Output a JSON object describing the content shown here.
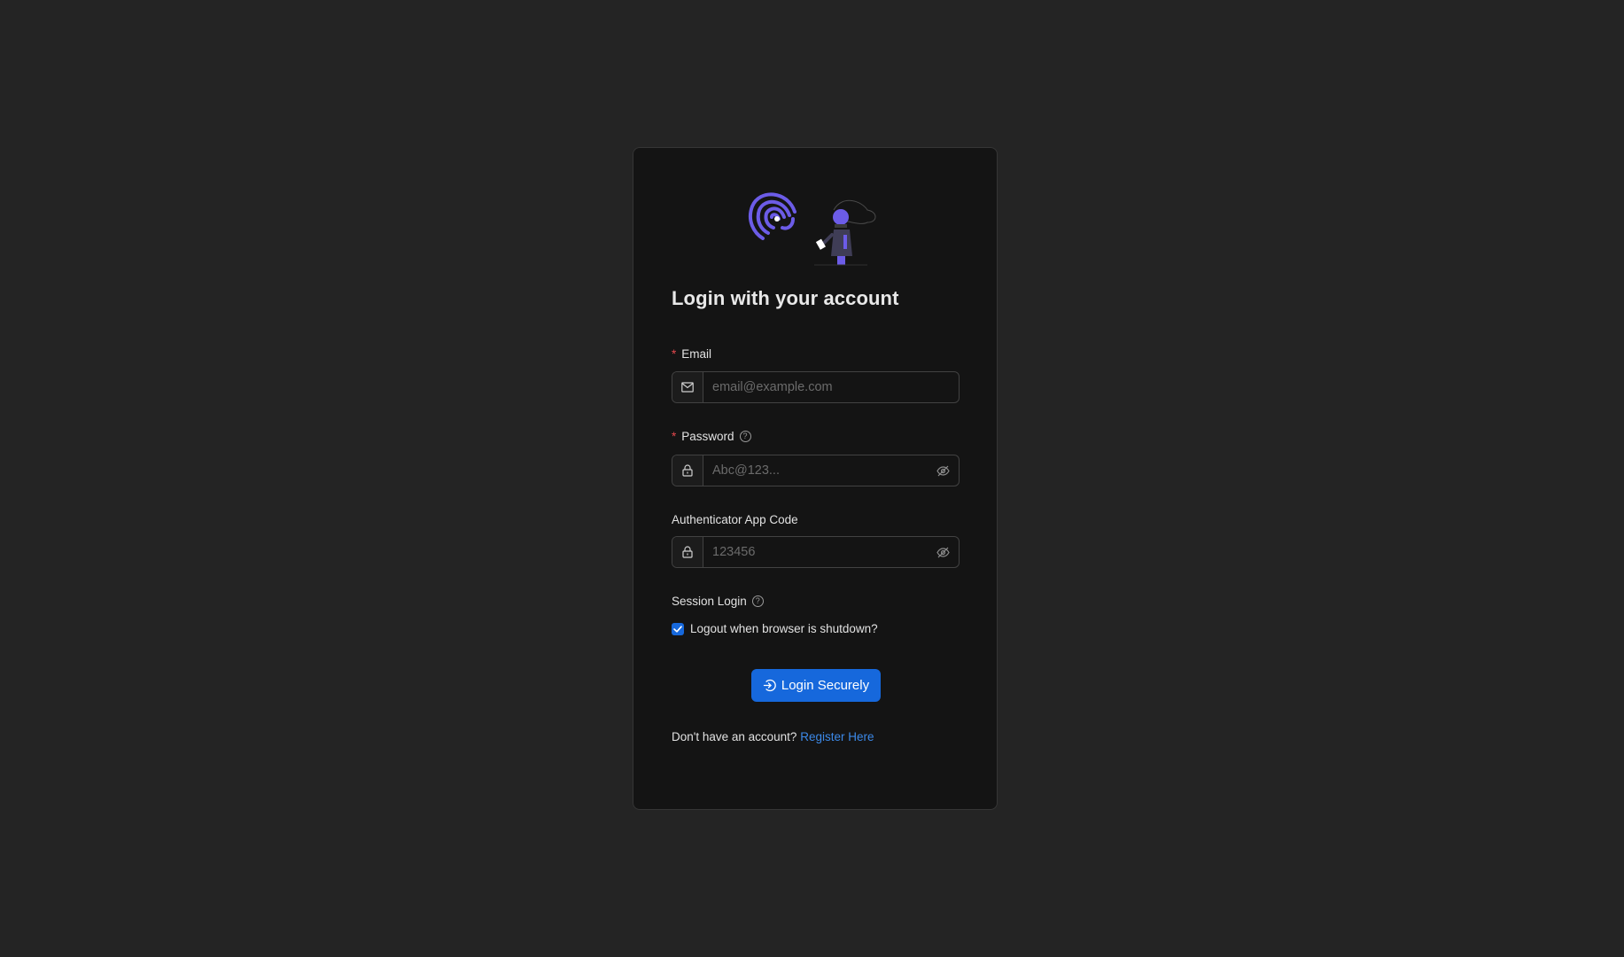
{
  "login": {
    "title": "Login with your account",
    "email": {
      "required_mark": "*",
      "label": "Email",
      "placeholder": "email@example.com",
      "value": ""
    },
    "password": {
      "required_mark": "*",
      "label": "Password",
      "help": "?",
      "placeholder": "Abc@123...",
      "value": ""
    },
    "authenticator": {
      "label": "Authenticator App Code",
      "placeholder": "123456",
      "value": ""
    },
    "session": {
      "label": "Session Login",
      "help": "?",
      "checkbox_label": "Logout when browser is shutdown?",
      "checked": true
    },
    "submit_label": "Login Securely",
    "register_prompt": "Don't have an account?",
    "register_link": "Register Here"
  },
  "colors": {
    "page_background": "#242424",
    "card_background": "#141414",
    "accent": "#1668dc",
    "link": "#3c89e8",
    "illustration_purple": "#6c5ce7",
    "required": "#e5484d"
  },
  "icons": {
    "illustration": "fingerprint-person-illustration",
    "email_addon": "mail-icon",
    "password_addon": "lock-icon",
    "password_toggle": "eye-invisible-icon",
    "auth_addon": "lock-icon",
    "auth_toggle": "eye-invisible-icon",
    "help": "question-circle-icon",
    "checkbox": "check-icon",
    "submit": "login-icon"
  }
}
